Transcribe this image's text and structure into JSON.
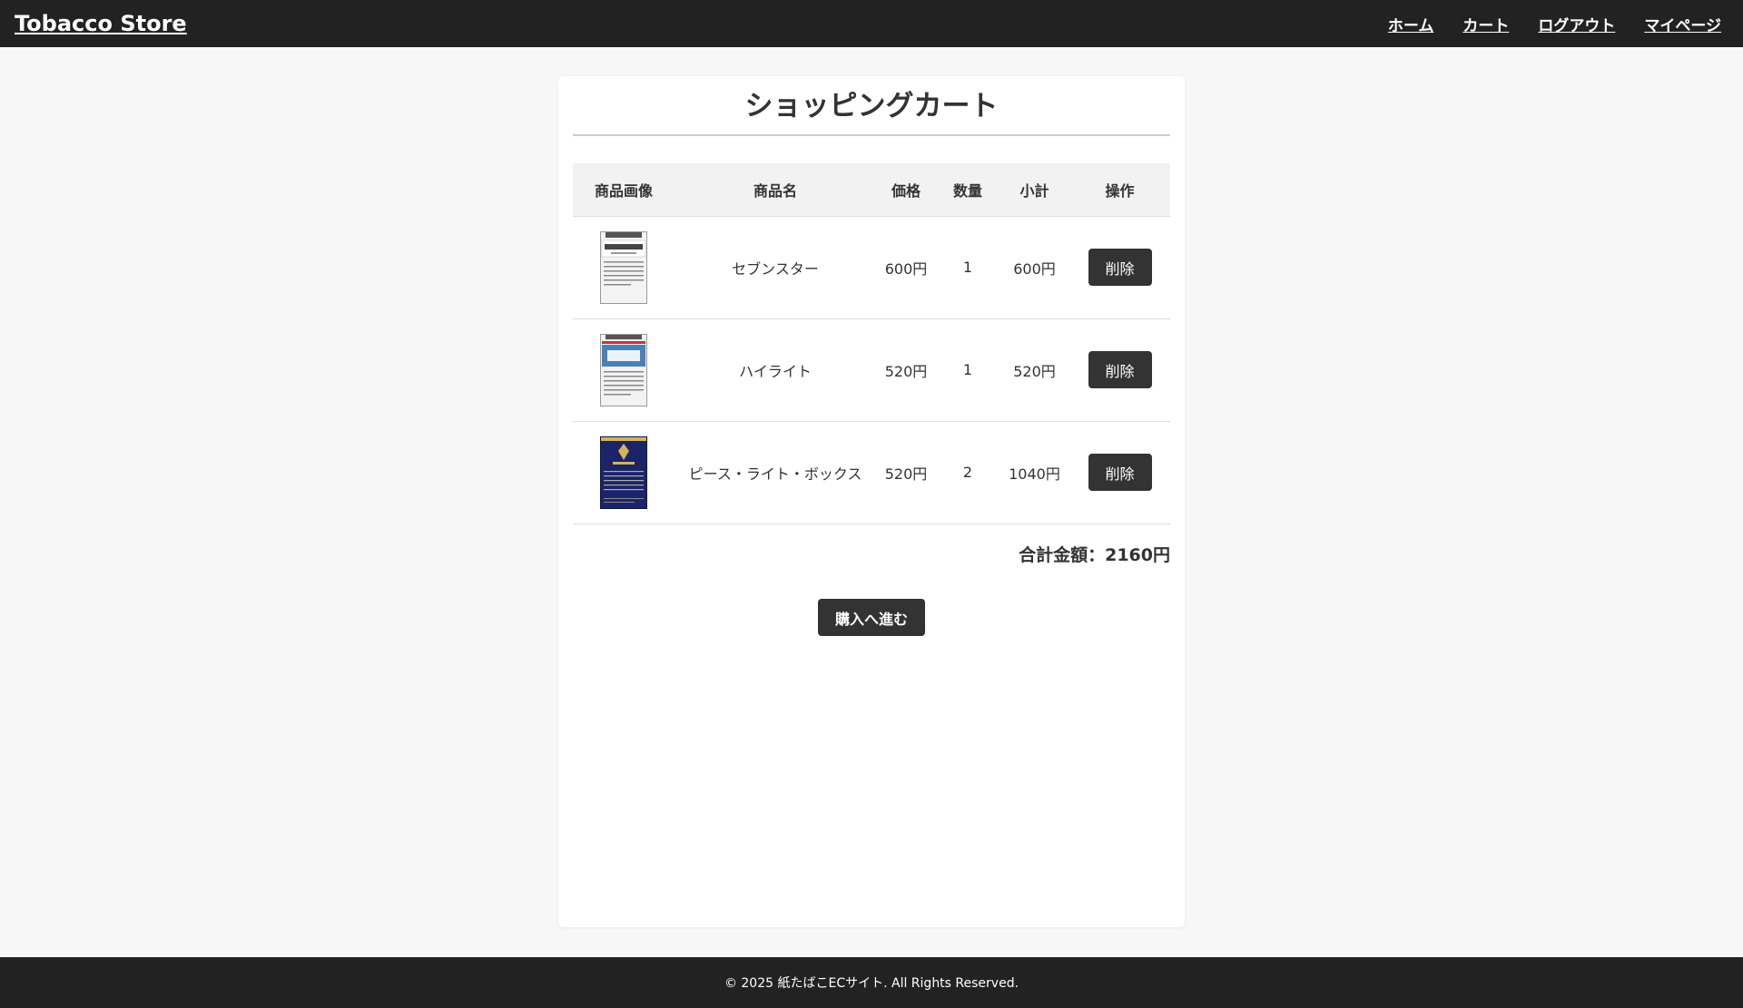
{
  "header": {
    "brand": "Tobacco Store",
    "nav": [
      "ホーム",
      "カート",
      "ログアウト",
      "マイページ"
    ]
  },
  "main": {
    "title": "ショッピングカート",
    "columns": [
      "商品画像",
      "商品名",
      "価格",
      "数量",
      "小計",
      "操作"
    ],
    "items": [
      {
        "name": "セブンスター",
        "price": "600円",
        "qty": "1",
        "subtotal": "600円",
        "image": "seven-stars-pack",
        "delete_label": "削除"
      },
      {
        "name": "ハイライト",
        "price": "520円",
        "qty": "1",
        "subtotal": "520円",
        "image": "hi-lite-pack",
        "delete_label": "削除"
      },
      {
        "name": "ピース・ライト・ボックス",
        "price": "520円",
        "qty": "2",
        "subtotal": "1040円",
        "image": "peace-light-box-pack",
        "delete_label": "削除"
      }
    ],
    "total": "合計金額：2160円",
    "checkout_label": "購入へ進む"
  },
  "footer": {
    "text": "© 2025 紙たばこECサイト. All Rights Reserved."
  },
  "colors": {
    "header_bg": "#222222",
    "button_bg": "#333333",
    "page_bg": "#f7f7f7"
  }
}
